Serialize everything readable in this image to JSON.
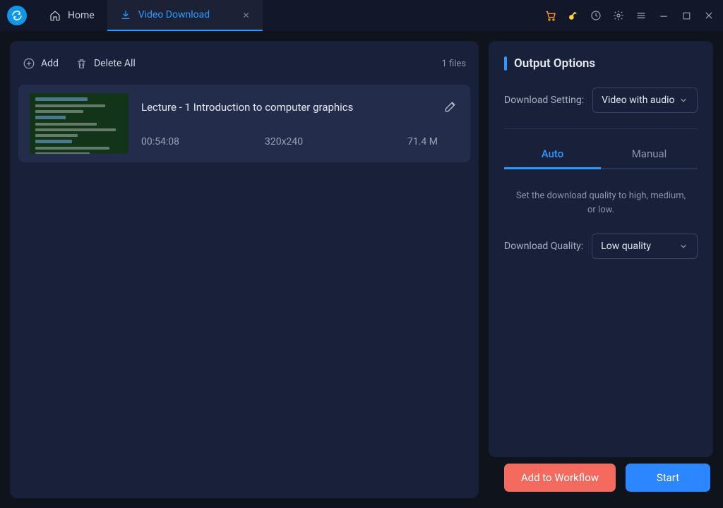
{
  "titlebar": {
    "home_label": "Home",
    "active_tab_label": "Video Download"
  },
  "toolbar": {
    "add_label": "Add",
    "delete_all_label": "Delete All",
    "file_count": "1 files"
  },
  "items": [
    {
      "title": "Lecture - 1 Introduction to computer graphics",
      "duration": "00:54:08",
      "resolution": "320x240",
      "size": "71.4 M"
    }
  ],
  "options": {
    "panel_title": "Output Options",
    "download_setting_label": "Download Setting:",
    "download_setting_value": "Video with audio",
    "tabs": {
      "auto": "Auto",
      "manual": "Manual"
    },
    "hint": "Set the download quality to high, medium, or low.",
    "download_quality_label": "Download Quality:",
    "download_quality_value": "Low quality"
  },
  "footer": {
    "add_to_workflow": "Add to Workflow",
    "start": "Start"
  }
}
